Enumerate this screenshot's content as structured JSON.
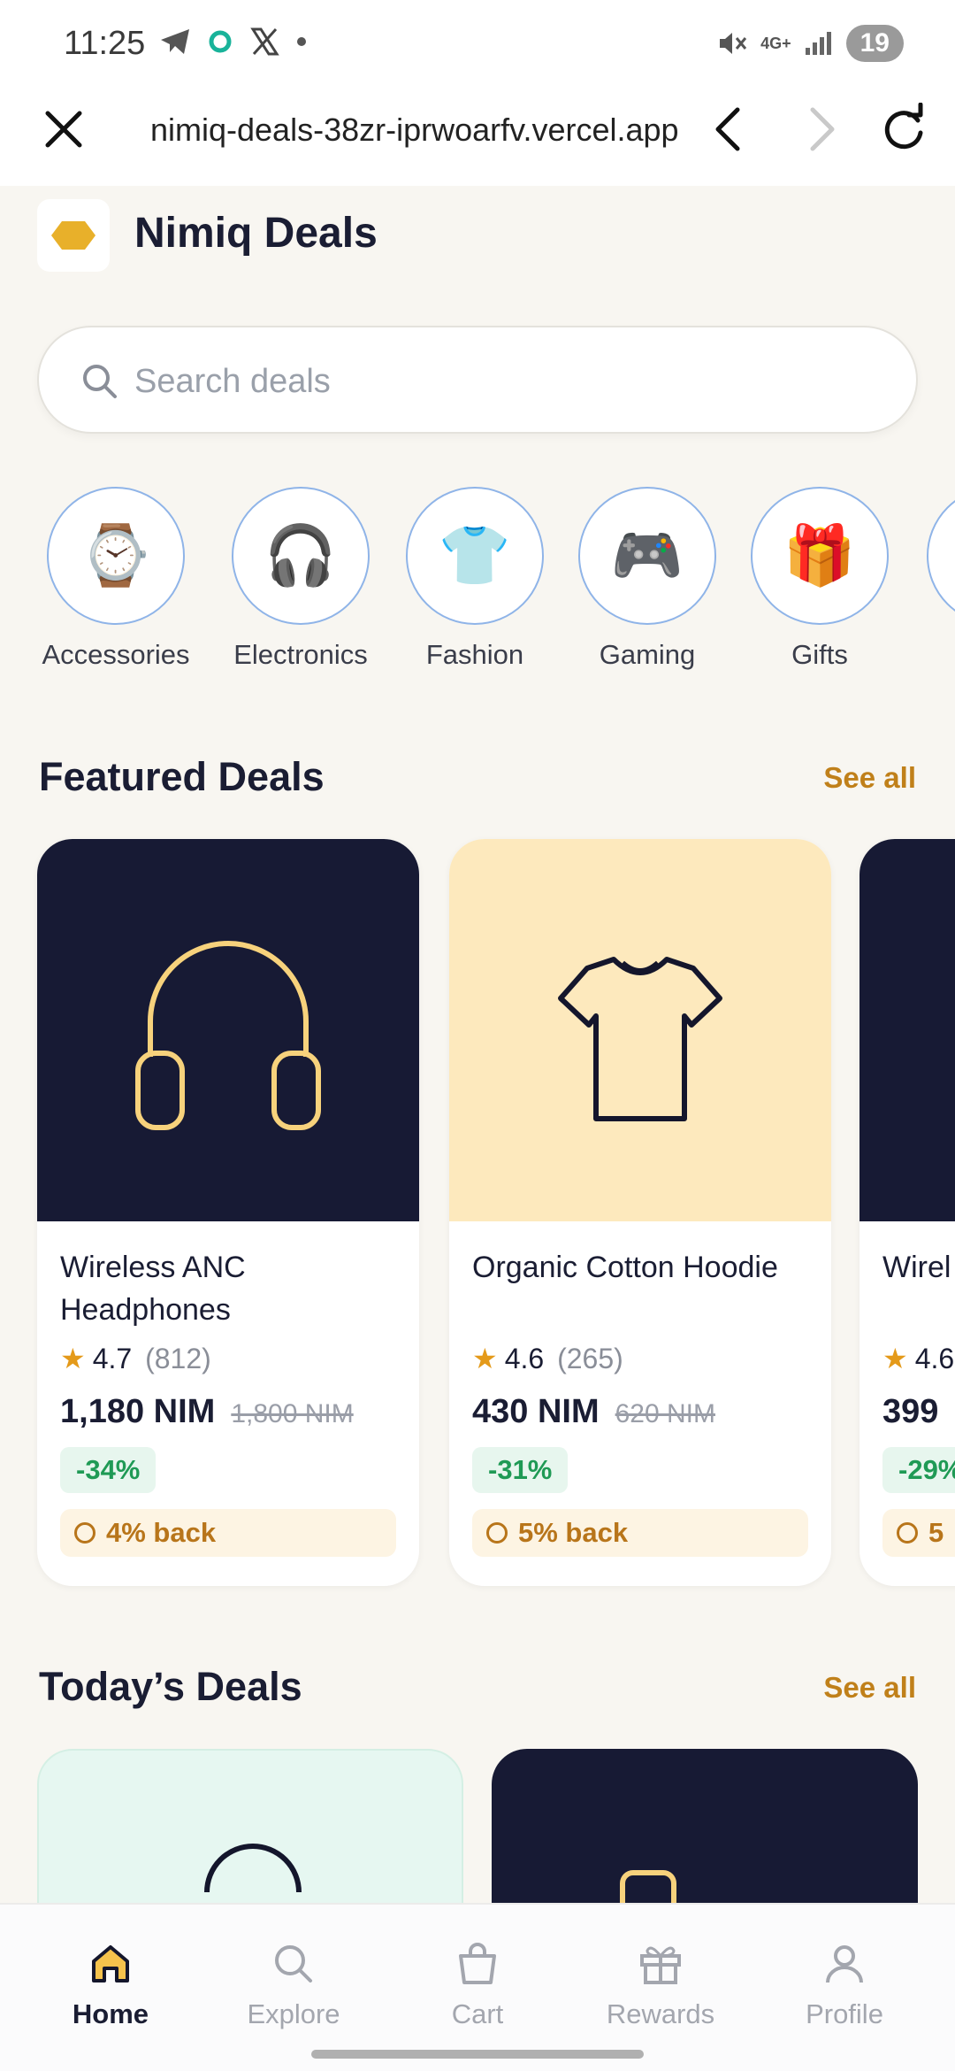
{
  "status_bar": {
    "time": "11:25",
    "network": "4G+",
    "battery": "19"
  },
  "browser": {
    "url": "nimiq-deals-38zr-iprwoarfv.vercel.app"
  },
  "app": {
    "title": "Nimiq Deals",
    "logo_color": "#e8b02a"
  },
  "search": {
    "placeholder": "Search deals",
    "value": ""
  },
  "categories": [
    {
      "label": "Accessories",
      "icon": "⌚"
    },
    {
      "label": "Electronics",
      "icon": "🎧"
    },
    {
      "label": "Fashion",
      "icon": "👕"
    },
    {
      "label": "Gaming",
      "icon": "🎮"
    },
    {
      "label": "Gifts",
      "icon": "🎁"
    }
  ],
  "featured": {
    "title": "Featured Deals",
    "see_all": "See all",
    "items": [
      {
        "name": "Wireless ANC Headphones",
        "rating": "4.7",
        "reviews": "(812)",
        "price": "1,180 NIM",
        "old_price": "1,800 NIM",
        "discount": "-34%",
        "cashback": "4% back",
        "bg": "#171a34",
        "icon": "headphones-icon"
      },
      {
        "name": "Organic Cotton Hoodie",
        "rating": "4.6",
        "reviews": "(265)",
        "price": "430 NIM",
        "old_price": "620 NIM",
        "discount": "-31%",
        "cashback": "5% back",
        "bg": "#fde9bd",
        "icon": "tshirt-icon"
      },
      {
        "name": "Wirel Cont",
        "rating": "4.6",
        "reviews": "",
        "price": "399",
        "old_price": "",
        "discount": "-29%",
        "cashback": "5",
        "bg": "#171a34",
        "icon": ""
      }
    ]
  },
  "today": {
    "title": "Today’s Deals",
    "see_all": "See all",
    "tiles": [
      {
        "bg": "#e6f7f1"
      },
      {
        "bg": "#171a34"
      }
    ]
  },
  "bottom_nav": [
    {
      "label": "Home",
      "icon": "home-icon",
      "active": true
    },
    {
      "label": "Explore",
      "icon": "search-icon",
      "active": false
    },
    {
      "label": "Cart",
      "icon": "bag-icon",
      "active": false
    },
    {
      "label": "Rewards",
      "icon": "gift-icon",
      "active": false
    },
    {
      "label": "Profile",
      "icon": "user-icon",
      "active": false
    }
  ],
  "colors": {
    "accent": "#c0801a",
    "navy": "#171a34",
    "success": "#1f9a55"
  }
}
